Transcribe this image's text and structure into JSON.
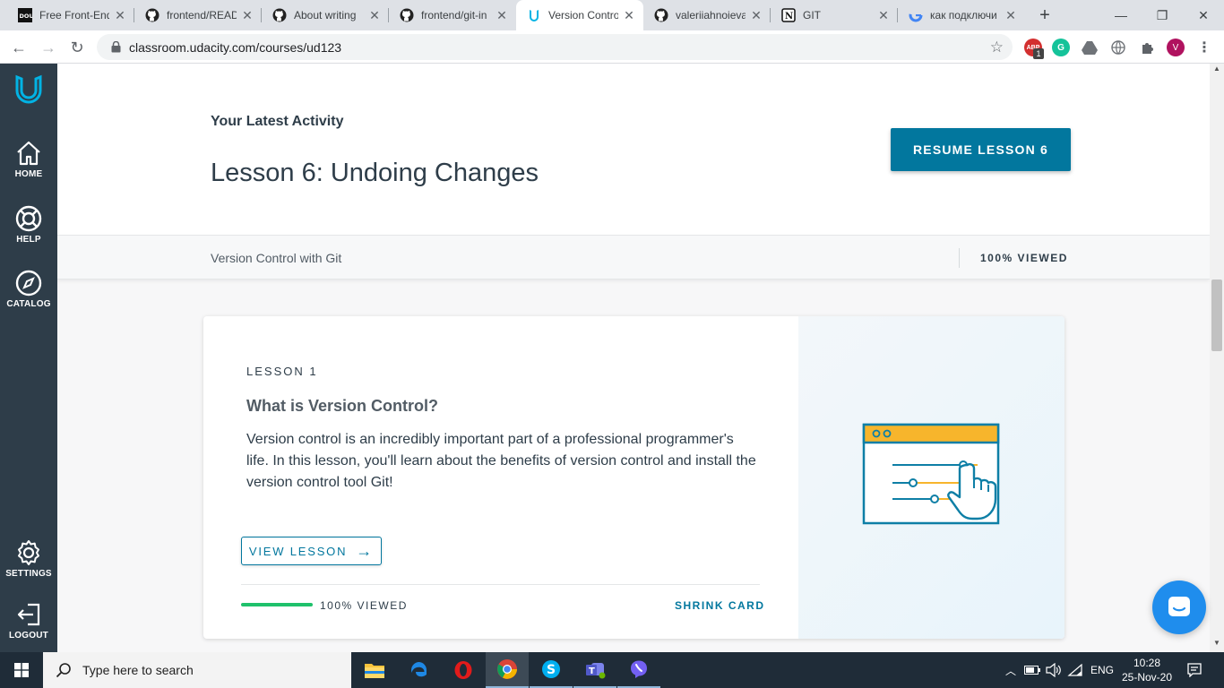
{
  "browser": {
    "tabs": [
      {
        "title": "Free Front-End",
        "favicon": "dou-icon"
      },
      {
        "title": "frontend/READ",
        "favicon": "github-icon"
      },
      {
        "title": "About writing",
        "favicon": "github-icon"
      },
      {
        "title": "frontend/git-in",
        "favicon": "github-icon"
      },
      {
        "title": "Version Contro",
        "favicon": "udacity-icon",
        "active": true
      },
      {
        "title": "valeriiahnoieva",
        "favicon": "github-icon"
      },
      {
        "title": "GIT",
        "favicon": "notion-icon"
      },
      {
        "title": "как подключи",
        "favicon": "google-icon"
      }
    ],
    "url": "classroom.udacity.com/courses/ud123",
    "profile_initial": "V",
    "extension_badge": "1",
    "extension_label": "ABP"
  },
  "sidebar": {
    "items": [
      {
        "label": "HOME",
        "icon": "home-icon"
      },
      {
        "label": "HELP",
        "icon": "lifebuoy-icon"
      },
      {
        "label": "CATALOG",
        "icon": "compass-icon"
      },
      {
        "label": "SETTINGS",
        "icon": "gear-icon"
      },
      {
        "label": "LOGOUT",
        "icon": "logout-icon"
      }
    ]
  },
  "hero": {
    "kicker": "Your Latest Activity",
    "title": "Lesson 6: Undoing Changes",
    "resume_label": "RESUME LESSON 6"
  },
  "course_bar": {
    "course_name": "Version Control with Git",
    "viewed": "100% VIEWED"
  },
  "lesson_card": {
    "number": "LESSON 1",
    "title": "What is Version Control?",
    "description": "Version control is an incredibly important part of a professional programmer's life. In this lesson, you'll learn about the benefits of version control and install the version control tool Git!",
    "view_label": "VIEW LESSON",
    "progress_fraction": 1.0,
    "viewed": "100% VIEWED",
    "shrink_label": "SHRINK CARD"
  },
  "taskbar": {
    "search_placeholder": "Type here to search",
    "apps": [
      "file-explorer-icon",
      "edge-icon",
      "opera-icon",
      "chrome-icon",
      "skype-icon",
      "teams-icon",
      "viber-icon"
    ],
    "language": "ENG",
    "time": "10:28",
    "date": "25-Nov-20"
  },
  "colors": {
    "udacity_dark": "#2e3d49",
    "udacity_blue": "#02779e",
    "udacity_cyan": "#02b3e4",
    "progress_green": "#1fc16b",
    "chat_blue": "#1f8ded"
  }
}
